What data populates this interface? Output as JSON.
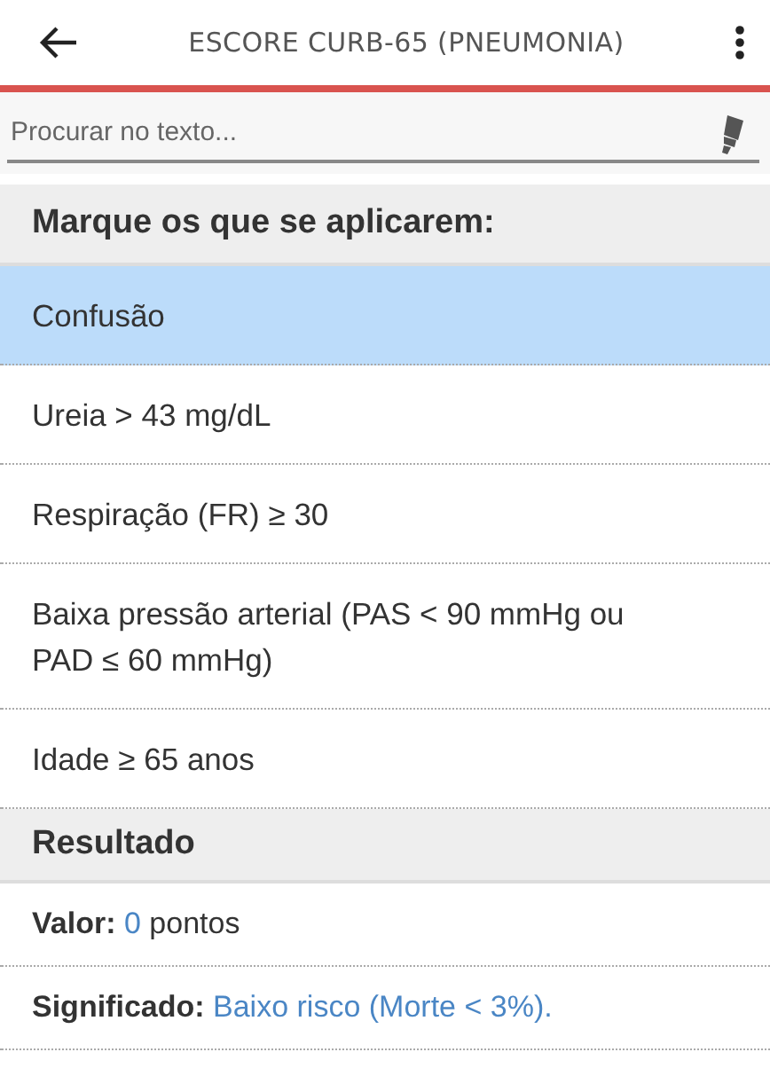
{
  "app_bar": {
    "title": "ESCORE CURB-65 (PNEUMONIA)"
  },
  "search": {
    "placeholder": "Procurar no texto..."
  },
  "criteria": {
    "heading": "Marque os que se aplicarem:",
    "items": [
      {
        "label": "Confusão",
        "selected": true
      },
      {
        "label": "Ureia > 43 mg/dL",
        "selected": false
      },
      {
        "label": "Respiração (FR) ≥ 30",
        "selected": false
      },
      {
        "label": "Baixa pressão arterial (PAS < 90 mmHg ou PAD ≤ 60 mmHg)",
        "selected": false
      },
      {
        "label": "Idade ≥ 65 anos",
        "selected": false
      }
    ]
  },
  "result": {
    "heading": "Resultado",
    "lines": [
      {
        "label": "Valor:",
        "value": "0",
        "suffix": "pontos"
      },
      {
        "label": "Significado:",
        "value": "Baixo risco (Morte < 3%)."
      }
    ]
  }
}
